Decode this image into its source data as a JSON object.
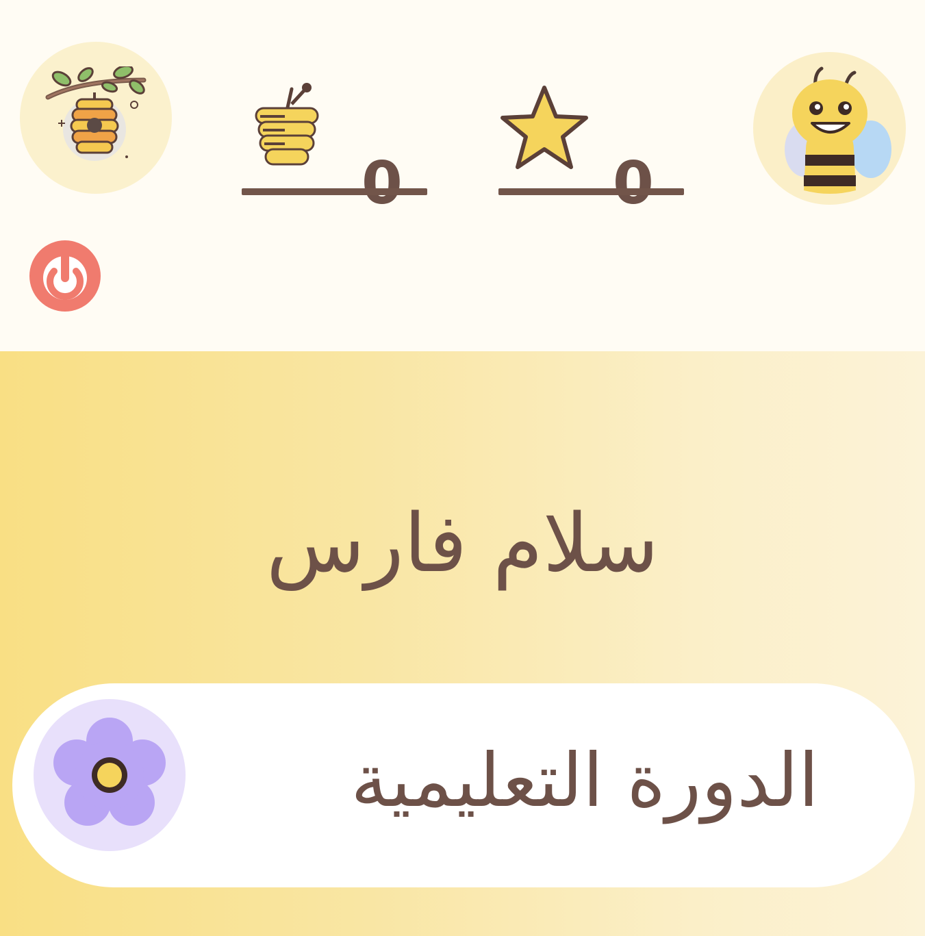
{
  "header": {
    "hive_icon": "beehive-icon",
    "avatar_icon": "bee-avatar-icon",
    "honey": {
      "icon": "honey-pot-icon",
      "count": "0"
    },
    "stars": {
      "icon": "star-icon",
      "count": "0"
    },
    "power_icon": "power-icon"
  },
  "main": {
    "greeting": "سلام فارس",
    "course": {
      "label": "الدورة التعليمية",
      "icon": "flower-icon"
    }
  },
  "colors": {
    "text": "#6d5148",
    "honey": "#f5d45c",
    "power": "#f07b6e",
    "flower": "#b9a5f4",
    "main_gradient_start": "#f9df84",
    "main_gradient_end": "#fcf3d8"
  }
}
